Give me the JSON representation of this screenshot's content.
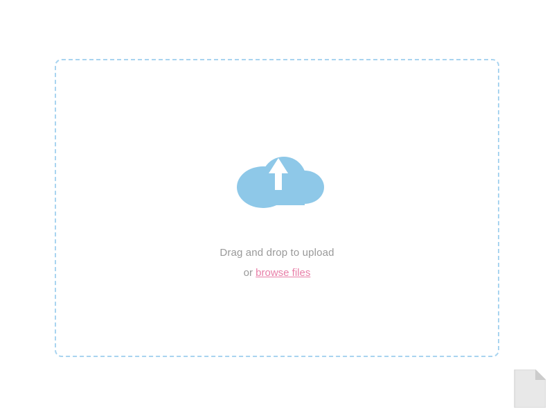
{
  "dropzone": {
    "drag_text": "Drag and drop to upload",
    "or_text": "or",
    "browse_label": "browse files"
  },
  "colors": {
    "cloud": "#8ec8e8",
    "border": "#a8d4f0",
    "text_gray": "#999999",
    "link_pink": "#e87fa8"
  }
}
